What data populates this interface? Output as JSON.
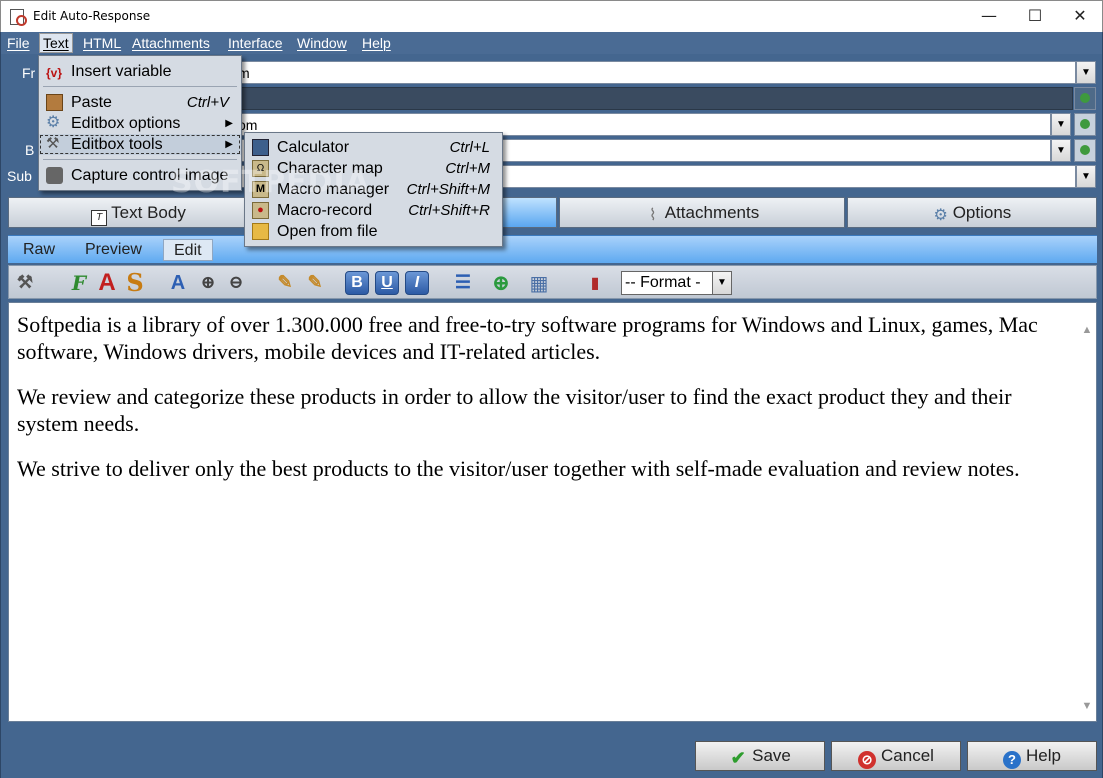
{
  "window": {
    "title": "Edit Auto-Response",
    "minimize": "—",
    "maximize": "☐",
    "close": "✕"
  },
  "menubar": [
    "File",
    "Text",
    "HTML",
    "Attachments",
    "Interface",
    "Window",
    "Help"
  ],
  "fields": {
    "from_label": "Fr",
    "from_value": "m",
    "to_value": "",
    "cc_value": "om",
    "bcc_label": "B",
    "bcc_value": "",
    "subject_label": "Sub",
    "subject_value": ""
  },
  "text_menu": {
    "items": [
      {
        "label": "Insert variable",
        "icon": "variable-icon"
      },
      {
        "label": "Paste",
        "shortcut": "Ctrl+V",
        "icon": "paste-icon"
      },
      {
        "label": "Editbox options",
        "icon": "gear-icon",
        "submenu": true
      },
      {
        "label": "Editbox tools",
        "icon": "tools-icon",
        "submenu": true
      },
      {
        "label": "Capture control image",
        "icon": "camera-icon"
      }
    ]
  },
  "tools_submenu": {
    "items": [
      {
        "label": "Calculator",
        "shortcut": "Ctrl+L",
        "icon": "calculator-icon"
      },
      {
        "label": "Character map",
        "shortcut": "Ctrl+M",
        "icon": "character-map-icon"
      },
      {
        "label": "Macro manager",
        "shortcut": "Ctrl+Shift+M",
        "icon": "macro-icon"
      },
      {
        "label": "Macro-record",
        "shortcut": "Ctrl+Shift+R",
        "icon": "record-icon"
      },
      {
        "label": "Open from file",
        "icon": "folder-icon"
      }
    ]
  },
  "tabs": [
    {
      "label": "Text Body",
      "icon": "text-body-icon"
    },
    {
      "label": "",
      "icon": ""
    },
    {
      "label": "Attachments",
      "icon": "paperclip-icon"
    },
    {
      "label": "Options",
      "icon": "gear-icon"
    }
  ],
  "subtabs": [
    "Raw",
    "Preview",
    "Edit"
  ],
  "toolbar": {
    "format_select": "-- Format -"
  },
  "editor": {
    "paragraphs": [
      "Softpedia is a library of over 1.300.000 free and free-to-try software programs for Windows and Linux, games, Mac software, Windows drivers, mobile devices and IT-related articles.",
      "We review and categorize these products in order to allow the visitor/user to find the exact product they and their system needs.",
      "We strive to deliver only the best products to the visitor/user together with self-made evaluation and review notes."
    ]
  },
  "buttons": {
    "save": "Save",
    "cancel": "Cancel",
    "help": "Help"
  },
  "watermark": "SOFTPEDIA",
  "colors": {
    "app_background": "#44668f",
    "accent_tab": "#5aa6f0",
    "save_green": "#2e9d2e",
    "cancel_red": "#d0312d",
    "help_blue": "#2a72c9"
  }
}
